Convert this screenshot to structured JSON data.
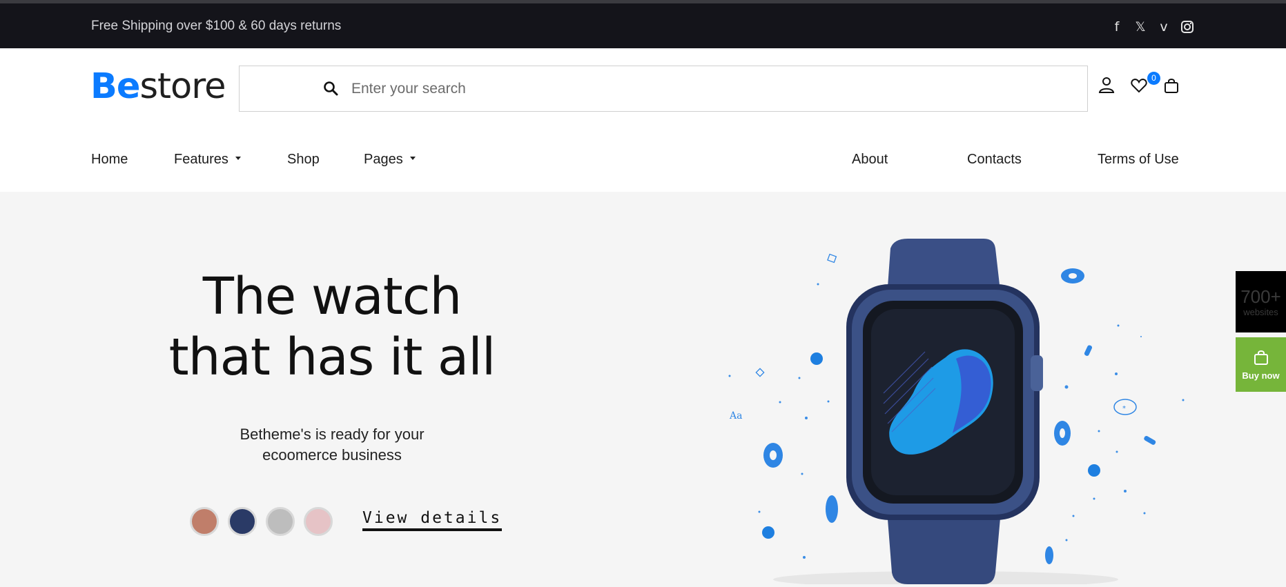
{
  "topbar": {
    "shipping_text": "Free Shipping over $100 & 60 days returns",
    "socials": [
      "facebook-icon",
      "x-icon",
      "vimeo-icon",
      "instagram-icon"
    ]
  },
  "header": {
    "logo_be": "Be",
    "logo_store": "store",
    "search_placeholder": "Enter your search",
    "wishlist_count": "0"
  },
  "nav": {
    "items": [
      {
        "label": "Home"
      },
      {
        "label": "Features"
      },
      {
        "label": "Shop"
      },
      {
        "label": "Pages"
      },
      {
        "label": "About"
      },
      {
        "label": "Contacts"
      },
      {
        "label": "Terms of Use"
      }
    ]
  },
  "hero": {
    "title_line1": "The watch",
    "title_line2": "that has it all",
    "subtitle_line1": "Betheme's is ready for your",
    "subtitle_line2": "ecoomerce business",
    "swatches": [
      "#c07e6a",
      "#2a3a66",
      "#bdbdbd",
      "#e6c3c6"
    ],
    "cta_label": "View details"
  },
  "side": {
    "count": "700+",
    "count_label": "websites",
    "buy_label": "Buy now"
  },
  "colors": {
    "accent": "#0b7bff",
    "topbar_bg": "#14141a",
    "buy_bg": "#76b53a"
  }
}
